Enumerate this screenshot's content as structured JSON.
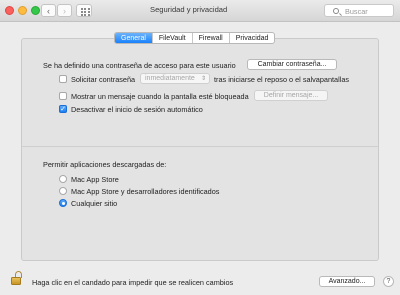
{
  "window": {
    "title": "Seguridad y privacidad",
    "search_placeholder": "Buscar"
  },
  "tabs": [
    {
      "label": "General",
      "active": true
    },
    {
      "label": "FileVault",
      "active": false
    },
    {
      "label": "Firewall",
      "active": false
    },
    {
      "label": "Privacidad",
      "active": false
    }
  ],
  "general": {
    "password_text": "Se ha definido una contraseña de acceso para este usuario",
    "change_password_button": "Cambiar contraseña...",
    "require_password": {
      "label_before": "Solicitar contraseña",
      "select_value": "inmediatamente",
      "label_after": "tras iniciarse el reposo o el salvapantallas",
      "checked": false
    },
    "show_message": {
      "label": "Mostrar un mensaje cuando la pantalla esté bloqueada",
      "button": "Definir mensaje...",
      "checked": false
    },
    "disable_autologin": {
      "label": "Desactivar el inicio de sesión automático",
      "checked": true
    }
  },
  "downloads": {
    "heading": "Permitir aplicaciones descargadas de:",
    "options": [
      {
        "label": "Mac App Store",
        "selected": false
      },
      {
        "label": "Mac App Store y desarrolladores identificados",
        "selected": false
      },
      {
        "label": "Cualquier sitio",
        "selected": true
      }
    ]
  },
  "footer": {
    "lock_text": "Haga clic en el candado para impedir que se realicen cambios",
    "advanced_button": "Avanzado...",
    "help_label": "?"
  },
  "icons": {
    "back": "‹",
    "forward": "›",
    "check": "✓",
    "select_arrows": "⇕"
  },
  "colors": {
    "accent": "#1a82fb",
    "window_bg": "#ececec",
    "lock": "#d4a437"
  }
}
